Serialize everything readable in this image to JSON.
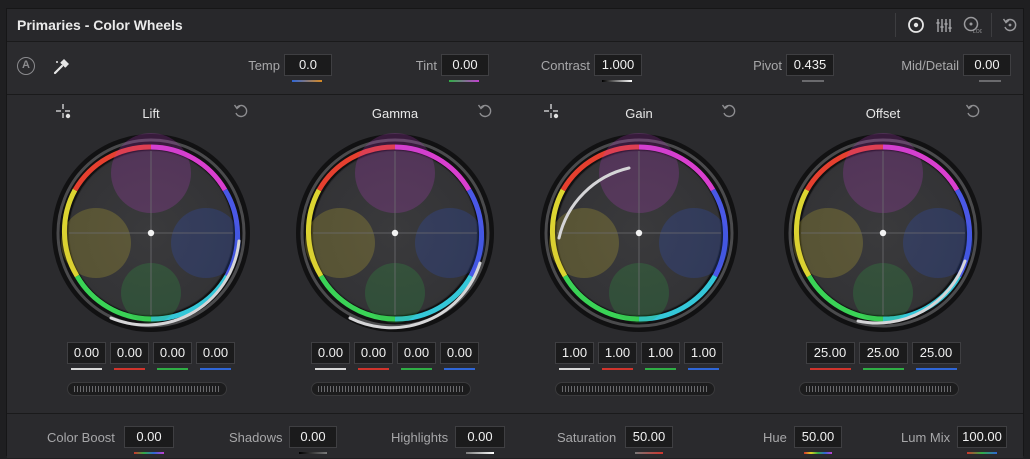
{
  "panel": {
    "title": "Primaries - Color Wheels"
  },
  "top": {
    "temp": {
      "label": "Temp",
      "value": "0.0"
    },
    "tint": {
      "label": "Tint",
      "value": "0.00"
    },
    "contrast": {
      "label": "Contrast",
      "value": "1.000"
    },
    "pivot": {
      "label": "Pivot",
      "value": "0.435"
    },
    "middetail": {
      "label": "Mid/Detail",
      "value": "0.00"
    },
    "auto_label": "A"
  },
  "wheels": [
    {
      "title": "Lift",
      "values": [
        "0.00",
        "0.00",
        "0.00",
        "0.00"
      ]
    },
    {
      "title": "Gamma",
      "values": [
        "0.00",
        "0.00",
        "0.00",
        "0.00"
      ]
    },
    {
      "title": "Gain",
      "values": [
        "1.00",
        "1.00",
        "1.00",
        "1.00"
      ]
    },
    {
      "title": "Offset",
      "values": [
        "25.00",
        "25.00",
        "25.00"
      ]
    }
  ],
  "bottom": {
    "color_boost": {
      "label": "Color Boost",
      "value": "0.00"
    },
    "shadows": {
      "label": "Shadows",
      "value": "0.00"
    },
    "highlights": {
      "label": "Highlights",
      "value": "0.00"
    },
    "saturation": {
      "label": "Saturation",
      "value": "50.00"
    },
    "hue": {
      "label": "Hue",
      "value": "50.00"
    },
    "lum_mix": {
      "label": "Lum Mix",
      "value": "100.00"
    }
  },
  "icons": {
    "header": [
      "color-wheels-mode-icon",
      "bars-mode-icon",
      "log-mode-icon",
      "panel-reset-icon"
    ],
    "wheel_picker": "crosshair-picker-icon",
    "wheel_reset": "reset-icon",
    "auto_balance": "auto-balance-icon",
    "white_picker": "eyedropper-icon"
  },
  "colors": {
    "background": "#2b2b2e",
    "value_box": "#1b1b1c",
    "text": "#cfcfcf",
    "accent_red": "#d0342c",
    "accent_green": "#2fae45",
    "accent_blue": "#2f66d6"
  }
}
